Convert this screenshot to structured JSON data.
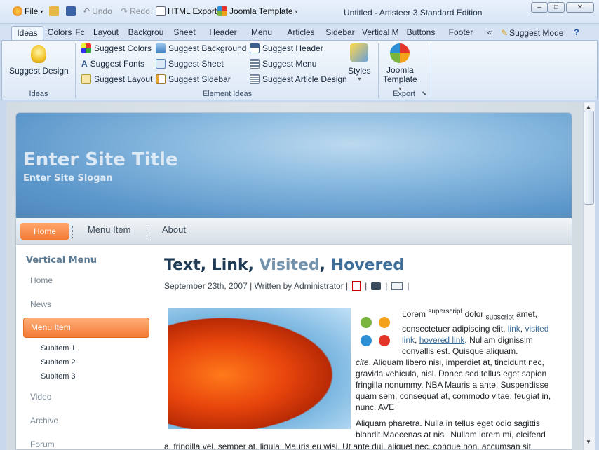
{
  "window": {
    "title": "Untitled - Artisteer 3 Standard Edition",
    "minimize": "–",
    "maximize": "□",
    "close": "✕"
  },
  "quick_access": {
    "file": "File",
    "undo": "Undo",
    "redo": "Redo",
    "html_export": "HTML Export",
    "joomla_template": "Joomla Template"
  },
  "tabs": [
    "Ideas",
    "Colors",
    "Fc",
    "Layout",
    "Backgrou",
    "Sheet",
    "Header",
    "Menu",
    "Articles",
    "Sidebar",
    "Vertical M",
    "Buttons",
    "Footer",
    "«",
    "Suggest Mode",
    "?"
  ],
  "ribbon": {
    "ideas_group": {
      "button": "Suggest Design",
      "label": "Ideas"
    },
    "element_ideas": {
      "label": "Element Ideas",
      "items": [
        "Suggest Colors",
        "Suggest Fonts",
        "Suggest Layout",
        "Suggest Background",
        "Suggest Sheet",
        "Suggest Sidebar",
        "Suggest Header",
        "Suggest Menu",
        "Suggest Article Design"
      ],
      "styles": "Styles"
    },
    "export": {
      "button_line1": "Joomla",
      "button_line2": "Template",
      "label": "Export"
    }
  },
  "site": {
    "title": "Enter Site Title",
    "slogan": "Enter Site Slogan",
    "menu": [
      "Home",
      "Menu Item",
      "About"
    ],
    "vertical_menu": {
      "title": "Vertical Menu",
      "items": [
        "Home",
        "News",
        "Menu Item",
        "Video",
        "Archive",
        "Forum"
      ],
      "subitems": [
        "Subitem 1",
        "Subitem 2",
        "Subitem 3"
      ]
    },
    "article": {
      "title_text": "Text",
      "title_sep1": ",",
      "title_link": "Link",
      "title_sep2": ",",
      "title_visited": "Visited",
      "title_sep3": ",",
      "title_hovered": "Hovered",
      "meta": "September 23th, 2007 | Written by Administrator |",
      "para1_a": "Lorem",
      "para1_sup": "superscript",
      "para1_b": "dolor",
      "para1_sub": "subscript",
      "para1_c": "amet,",
      "para1_d": "consectetuer adipiscing elit,",
      "para1_link": "link",
      "para1_visited": "visited link",
      "para1_hovered": "hovered link",
      "para1_e": ". Nullam dignissim convallis est. Quisque aliquam.",
      "para1_cite": "cite",
      "para1_f": ". Aliquam libero nisi, imperdiet at, tincidunt nec, gravida vehicula, nisl. Donec sed tellus eget sapien fringilla nonummy. NBA Mauris a ante. Suspendisse quam sem, consequat at, commodo vitae, feugiat in, nunc. AVE",
      "para2": "Aliquam pharetra. Nulla in tellus eget odio sagittis blandit.Maecenas at nisl. Nullam lorem mi, eleifend",
      "para3": "a, fringilla vel, semper at, ligula. Mauris eu wisi. Ut ante dui, aliquet nec, congue non, accumsan sit"
    }
  },
  "colors": {
    "accent_orange": "#f47a35",
    "header_blue": "#5c97cb",
    "link_blue": "#3d6d99"
  }
}
